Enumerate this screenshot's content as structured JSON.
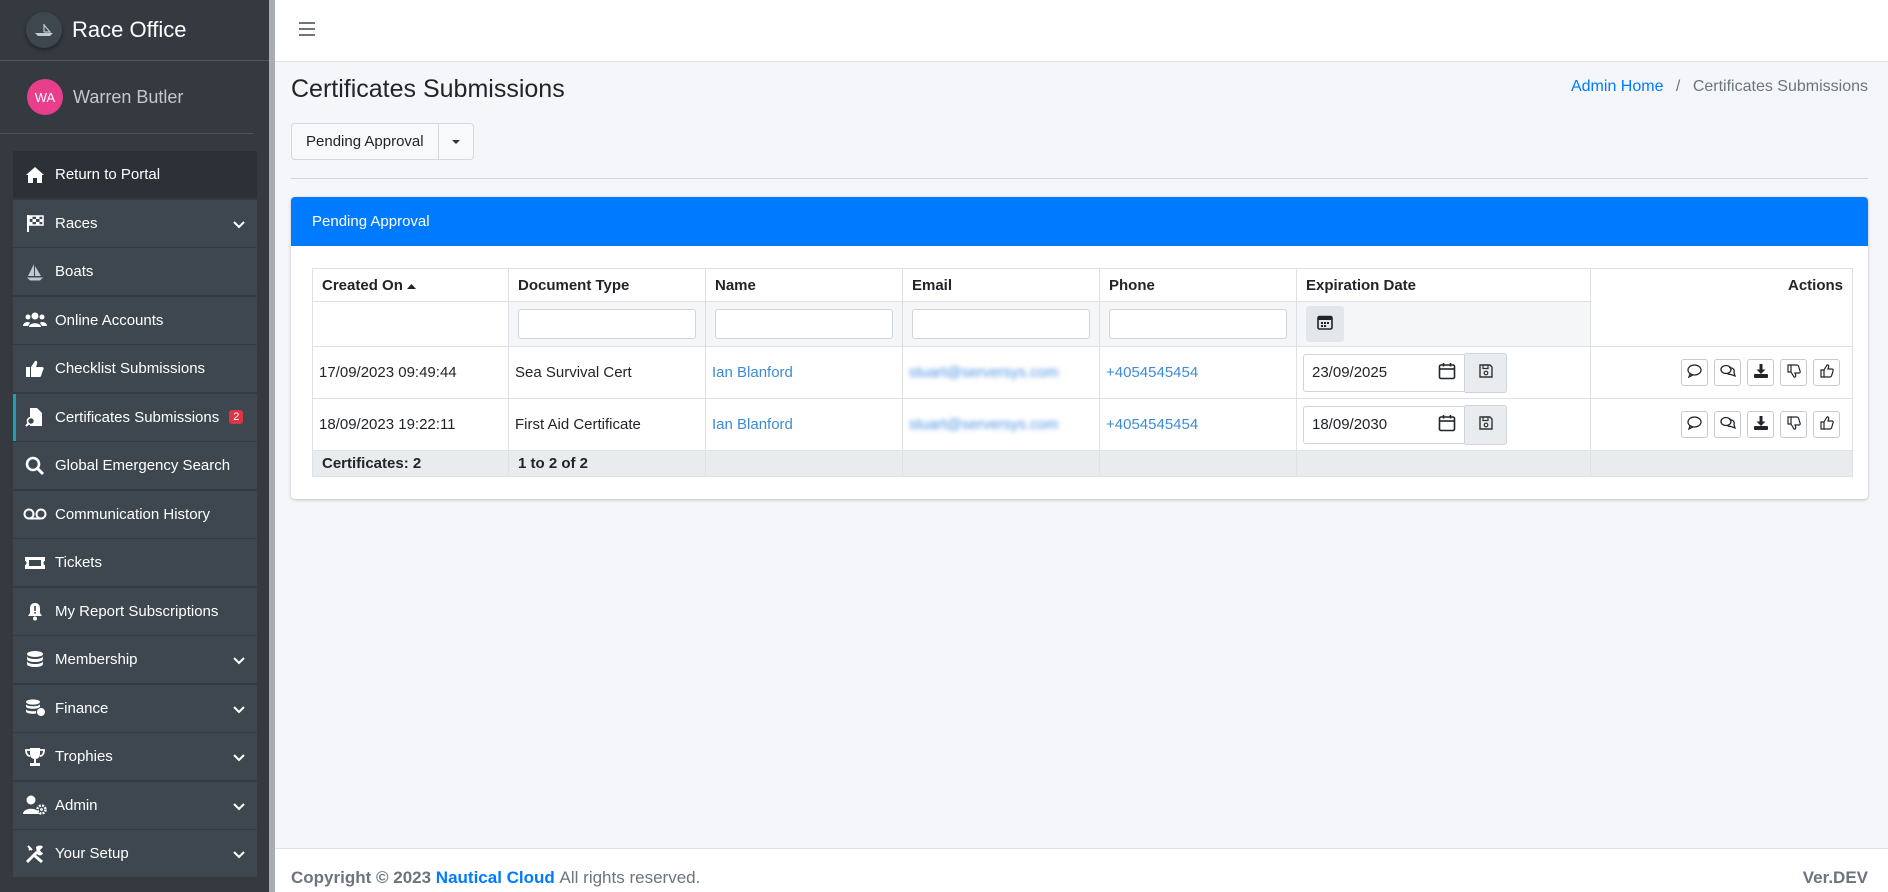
{
  "app": {
    "title": "Race Office"
  },
  "user": {
    "initials": "WA",
    "name": "Warren Butler"
  },
  "sidebar": {
    "items": [
      {
        "label": "Return to Portal"
      },
      {
        "label": "Races"
      },
      {
        "label": "Boats"
      },
      {
        "label": "Online Accounts"
      },
      {
        "label": "Checklist Submissions"
      },
      {
        "label": "Certificates Submissions",
        "badge": "2"
      },
      {
        "label": "Global Emergency Search"
      },
      {
        "label": "Communication History"
      },
      {
        "label": "Tickets"
      },
      {
        "label": "My Report Subscriptions"
      },
      {
        "label": "Membership"
      },
      {
        "label": "Finance"
      },
      {
        "label": "Trophies"
      },
      {
        "label": "Admin"
      },
      {
        "label": "Your Setup"
      }
    ]
  },
  "page": {
    "title": "Certificates Submissions",
    "breadcrumb": {
      "home": "Admin Home",
      "sep": "/",
      "current": "Certificates Submissions"
    },
    "filter_dropdown": "Pending Approval"
  },
  "card": {
    "header": "Pending Approval",
    "columns": {
      "created_on": "Created On",
      "document_type": "Document Type",
      "name": "Name",
      "email": "Email",
      "phone": "Phone",
      "expiration_date": "Expiration Date",
      "actions": "Actions"
    },
    "rows": [
      {
        "created_on": "17/09/2023 09:49:44",
        "document_type": "Sea Survival Cert",
        "name": "Ian Blanford",
        "email": "stuart@serversys.com",
        "phone": "+4054545454",
        "expiration": "23/09/2025"
      },
      {
        "created_on": "18/09/2023 19:22:11",
        "document_type": "First Aid Certificate",
        "name": "Ian Blanford",
        "email": "stuart@serversys.com",
        "phone": "+4054545454",
        "expiration": "18/09/2030"
      }
    ],
    "summary": {
      "count": "Certificates: 2",
      "range": "1 to 2 of 2"
    }
  },
  "footer": {
    "copyright": "Copyright © 2023",
    "company": "Nautical Cloud",
    "rights": "All rights reserved.",
    "version": "Ver.DEV"
  },
  "colors": {
    "primary": "#007bff",
    "sidebar": "#343a40",
    "badge": "#dc3545",
    "avatar": "#e83e8c"
  }
}
